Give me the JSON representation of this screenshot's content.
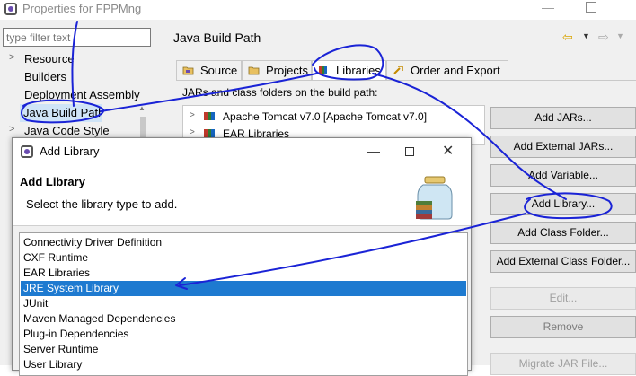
{
  "props_window": {
    "title": "Properties for FPPMng",
    "min_glyph": "—",
    "filter_placeholder": "type filter text",
    "nav_items": [
      {
        "arrow": ">",
        "label": "Resource"
      },
      {
        "arrow": "",
        "label": "Builders"
      },
      {
        "arrow": "",
        "label": "Deployment Assembly"
      },
      {
        "arrow": "",
        "label": "Java Build Path"
      },
      {
        "arrow": ">",
        "label": "Java Code Style"
      }
    ],
    "selected_nav": "Java Build Path",
    "section_title": "Java Build Path",
    "tabs": [
      {
        "label": "Source"
      },
      {
        "label": "Projects"
      },
      {
        "label": "Libraries"
      },
      {
        "label": "Order and Export"
      }
    ],
    "active_tab": "Libraries",
    "jars_label": "JARs and class folders on the build path:",
    "build_path_entries": [
      {
        "label": "Apache Tomcat v7.0 [Apache Tomcat v7.0]"
      },
      {
        "label": "EAR Libraries"
      }
    ],
    "buttons": {
      "add_jars": "Add JARs...",
      "add_external_jars": "Add External JARs...",
      "add_variable": "Add Variable...",
      "add_library": "Add Library...",
      "add_class_folder": "Add Class Folder...",
      "add_external_class_folder": "Add External Class Folder...",
      "edit": "Edit...",
      "remove": "Remove",
      "migrate_jar": "Migrate JAR File..."
    }
  },
  "add_library_dialog": {
    "title": "Add Library",
    "heading": "Add Library",
    "description": "Select the library type to add.",
    "library_types": [
      "Connectivity Driver Definition",
      "CXF Runtime",
      "EAR Libraries",
      "JRE System Library",
      "JUnit",
      "Maven Managed Dependencies",
      "Plug-in Dependencies",
      "Server Runtime",
      "User Library"
    ],
    "selected_type": "JRE System Library"
  },
  "colors": {
    "selection": "#1e7ad0",
    "annotation_ink": "#1a23d6",
    "nav_selection": "#cfe4f7"
  }
}
